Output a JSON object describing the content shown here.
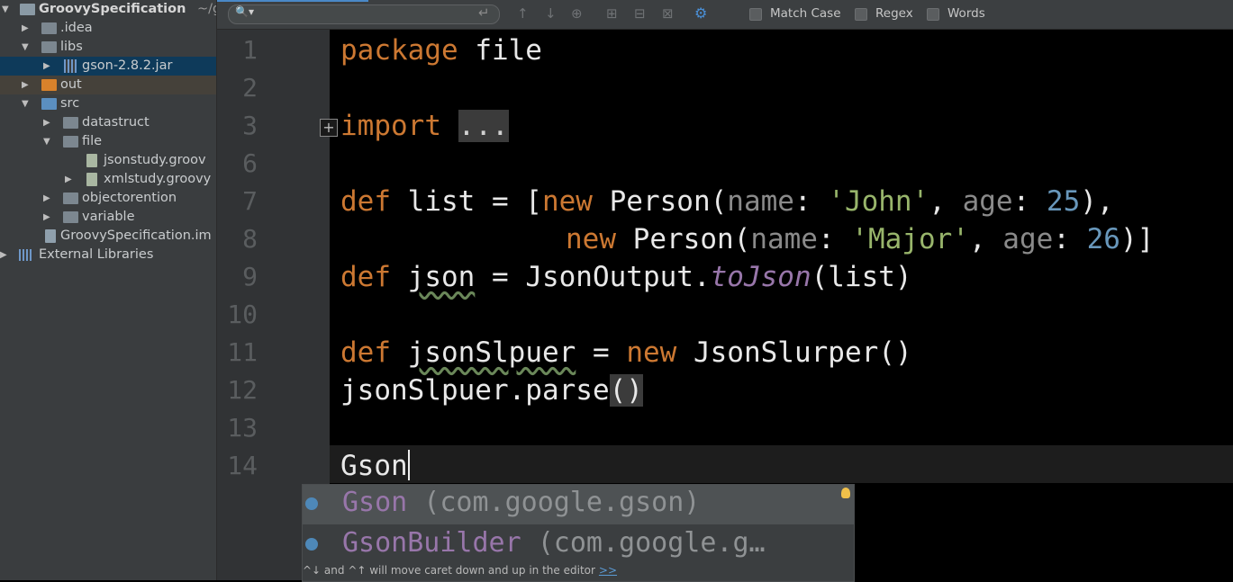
{
  "project": {
    "root_name": "GroovySpecification",
    "root_path": "~/g",
    "items": [
      {
        "label": ".idea"
      },
      {
        "label": "libs"
      },
      {
        "label": "gson-2.8.2.jar"
      },
      {
        "label": "out"
      },
      {
        "label": "src"
      },
      {
        "label": "datastruct"
      },
      {
        "label": "file"
      },
      {
        "label": "jsonstudy.groov"
      },
      {
        "label": "xmlstudy.groovy"
      },
      {
        "label": "objectorention"
      },
      {
        "label": "variable"
      },
      {
        "label": "GroovySpecification.im"
      },
      {
        "label": "External Libraries"
      }
    ]
  },
  "findbar": {
    "search_value": "",
    "options": {
      "match_case": "Match Case",
      "regex": "Regex",
      "words": "Words"
    }
  },
  "editor": {
    "line_numbers": [
      "1",
      "2",
      "3",
      "6",
      "7",
      "8",
      "9",
      "10",
      "11",
      "12",
      "13",
      "14"
    ],
    "code": {
      "l1_kw": "package",
      "l1_rest": " file",
      "l3_kw": "import",
      "l3_fold": "...",
      "l7_a": "def",
      "l7_b": " list = [",
      "l7_c": "new",
      "l7_d": " Person(",
      "l7_e": "name",
      "l7_f": ": ",
      "l7_g": "'John'",
      "l7_h": ", ",
      "l7_i": "age",
      "l7_j": ": ",
      "l7_k": "25",
      "l7_l": "),",
      "l8_a": "new",
      "l8_b": " Person(",
      "l8_c": "name",
      "l8_d": ": ",
      "l8_e": "'Major'",
      "l8_f": ", ",
      "l8_g": "age",
      "l8_h": ": ",
      "l8_i": "26",
      "l8_j": ")]",
      "l9_a": "def",
      "l9_b": "json",
      "l9_c": " = JsonOutput.",
      "l9_d": "toJson",
      "l9_e": "(list)",
      "l11_a": "def",
      "l11_b": "jsonSlpuer",
      "l11_c": " = ",
      "l11_d": "new",
      "l11_e": " JsonSlurper()",
      "l12_a": "jsonSlpuer.parse",
      "l12_b": "()",
      "l14_a": "Gson"
    }
  },
  "completion": {
    "items": [
      {
        "name": "Gson",
        "pkg": " (com.google.gson)"
      },
      {
        "name": "GsonBuilder",
        "pkg": " (com.google.g…"
      }
    ],
    "hint": "^↓ and ^↑ will move caret down and up in the editor",
    "hint_link": ">>"
  }
}
